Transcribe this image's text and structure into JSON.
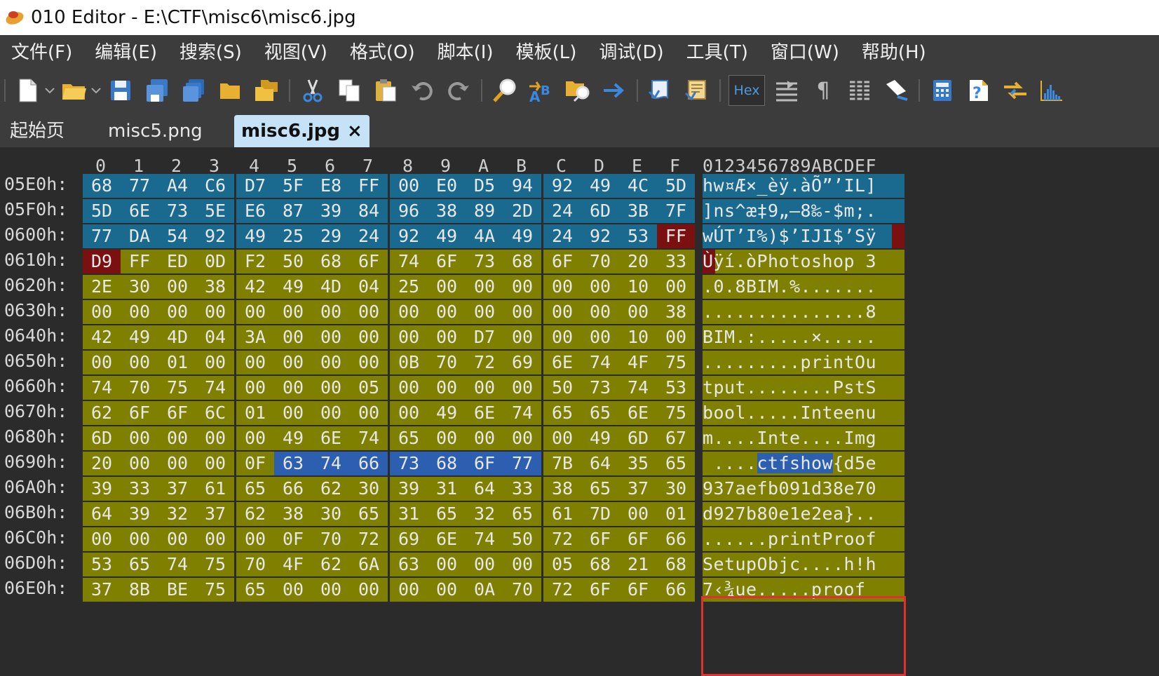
{
  "window": {
    "title": "010 Editor - E:\\CTF\\misc6\\misc6.jpg"
  },
  "menu": [
    "文件(F)",
    "编辑(E)",
    "搜索(S)",
    "视图(V)",
    "格式(O)",
    "脚本(I)",
    "模板(L)",
    "调试(D)",
    "工具(T)",
    "窗口(W)",
    "帮助(H)"
  ],
  "toolbar": {
    "icons": [
      "new-file-icon",
      "open-folder-icon",
      "save-icon",
      "save-as-icon",
      "save-all-icon",
      "open-folder-small-icon",
      "open-multiple-icon",
      "cut-icon",
      "copy-icon",
      "paste-icon",
      "undo-icon",
      "redo-icon",
      "find-icon",
      "replace-icon",
      "find-in-files-icon",
      "goto-icon",
      "run-script-icon",
      "run-template-icon",
      "hex-mode-icon",
      "compare-icon",
      "pilcrow-icon",
      "columns-icon",
      "highlight-icon",
      "calculator-icon",
      "help-icon",
      "swap-icon",
      "histogram-icon"
    ],
    "hex_label": "Hex"
  },
  "tabs": [
    {
      "label": "起始页",
      "active": false
    },
    {
      "label": "misc5.png",
      "active": false
    },
    {
      "label": "misc6.jpg",
      "active": true,
      "close": "×"
    }
  ],
  "hex_header": [
    "0",
    "1",
    "2",
    "3",
    "4",
    "5",
    "6",
    "7",
    "8",
    "9",
    "A",
    "B",
    "C",
    "D",
    "E",
    "F"
  ],
  "ascii_header": "0123456789ABCDEF",
  "rows": [
    {
      "addr": "05E0h:",
      "bytes": [
        "68",
        "77",
        "A4",
        "C6",
        "D7",
        "5F",
        "E8",
        "FF",
        "00",
        "E0",
        "D5",
        "94",
        "92",
        "49",
        "4C",
        "5D"
      ],
      "ascii": "hw¤Æ×_èÿ.àÕ”’IL]"
    },
    {
      "addr": "05F0h:",
      "bytes": [
        "5D",
        "6E",
        "73",
        "5E",
        "E6",
        "87",
        "39",
        "84",
        "96",
        "38",
        "89",
        "2D",
        "24",
        "6D",
        "3B",
        "7F"
      ],
      "ascii": "]ns^æ‡9„–8‰-$m;."
    },
    {
      "addr": "0600h:",
      "bytes": [
        "77",
        "DA",
        "54",
        "92",
        "49",
        "25",
        "29",
        "24",
        "92",
        "49",
        "4A",
        "49",
        "24",
        "92",
        "53",
        "FF"
      ],
      "ascii": "wÚT’I%)$’IJI$’Sÿ"
    },
    {
      "addr": "0610h:",
      "bytes": [
        "D9",
        "FF",
        "ED",
        "0D",
        "F2",
        "50",
        "68",
        "6F",
        "74",
        "6F",
        "73",
        "68",
        "6F",
        "70",
        "20",
        "33"
      ],
      "ascii": "Ùÿí.òPhotoshop 3"
    },
    {
      "addr": "0620h:",
      "bytes": [
        "2E",
        "30",
        "00",
        "38",
        "42",
        "49",
        "4D",
        "04",
        "25",
        "00",
        "00",
        "00",
        "00",
        "00",
        "10",
        "00"
      ],
      "ascii": ".0.8BIM.%......."
    },
    {
      "addr": "0630h:",
      "bytes": [
        "00",
        "00",
        "00",
        "00",
        "00",
        "00",
        "00",
        "00",
        "00",
        "00",
        "00",
        "00",
        "00",
        "00",
        "00",
        "38"
      ],
      "ascii": "...............8"
    },
    {
      "addr": "0640h:",
      "bytes": [
        "42",
        "49",
        "4D",
        "04",
        "3A",
        "00",
        "00",
        "00",
        "00",
        "00",
        "D7",
        "00",
        "00",
        "00",
        "10",
        "00"
      ],
      "ascii": "BIM.:.....×....."
    },
    {
      "addr": "0650h:",
      "bytes": [
        "00",
        "00",
        "01",
        "00",
        "00",
        "00",
        "00",
        "00",
        "0B",
        "70",
        "72",
        "69",
        "6E",
        "74",
        "4F",
        "75"
      ],
      "ascii": ".........printOu"
    },
    {
      "addr": "0660h:",
      "bytes": [
        "74",
        "70",
        "75",
        "74",
        "00",
        "00",
        "00",
        "05",
        "00",
        "00",
        "00",
        "00",
        "50",
        "73",
        "74",
        "53"
      ],
      "ascii": "tput........PstS"
    },
    {
      "addr": "0670h:",
      "bytes": [
        "62",
        "6F",
        "6F",
        "6C",
        "01",
        "00",
        "00",
        "00",
        "00",
        "49",
        "6E",
        "74",
        "65",
        "65",
        "6E",
        "75"
      ],
      "ascii": "bool.....Inteenu"
    },
    {
      "addr": "0680h:",
      "bytes": [
        "6D",
        "00",
        "00",
        "00",
        "00",
        "49",
        "6E",
        "74",
        "65",
        "00",
        "00",
        "00",
        "00",
        "49",
        "6D",
        "67"
      ],
      "ascii": "m....Inte....Img"
    },
    {
      "addr": "0690h:",
      "bytes": [
        "20",
        "00",
        "00",
        "00",
        "0F",
        "63",
        "74",
        "66",
        "73",
        "68",
        "6F",
        "77",
        "7B",
        "64",
        "35",
        "65"
      ],
      "ascii": " ....ctfshow{d5e"
    },
    {
      "addr": "06A0h:",
      "bytes": [
        "39",
        "33",
        "37",
        "61",
        "65",
        "66",
        "62",
        "30",
        "39",
        "31",
        "64",
        "33",
        "38",
        "65",
        "37",
        "30"
      ],
      "ascii": "937aefb091d38e70"
    },
    {
      "addr": "06B0h:",
      "bytes": [
        "64",
        "39",
        "32",
        "37",
        "62",
        "38",
        "30",
        "65",
        "31",
        "65",
        "32",
        "65",
        "61",
        "7D",
        "00",
        "01"
      ],
      "ascii": "d927b80e1e2ea}.."
    },
    {
      "addr": "06C0h:",
      "bytes": [
        "00",
        "00",
        "00",
        "00",
        "00",
        "0F",
        "70",
        "72",
        "69",
        "6E",
        "74",
        "50",
        "72",
        "6F",
        "6F",
        "66"
      ],
      "ascii": "......printProof"
    },
    {
      "addr": "06D0h:",
      "bytes": [
        "53",
        "65",
        "74",
        "75",
        "70",
        "4F",
        "62",
        "6A",
        "63",
        "00",
        "00",
        "00",
        "05",
        "68",
        "21",
        "68"
      ],
      "ascii": "SetupObjc....h!h"
    },
    {
      "addr": "06E0h:",
      "bytes": [
        "37",
        "8B",
        "BE",
        "75",
        "65",
        "00",
        "00",
        "00",
        "00",
        "00",
        "0A",
        "70",
        "72",
        "6F",
        "6F",
        "66"
      ],
      "ascii": "7‹¾ue.....proof"
    }
  ],
  "colors": {
    "blue_region": "#1a6a8f",
    "olive_region": "#808000",
    "marker": "#7a1010",
    "selection": "#2c5fb0",
    "box": "#e03030"
  }
}
